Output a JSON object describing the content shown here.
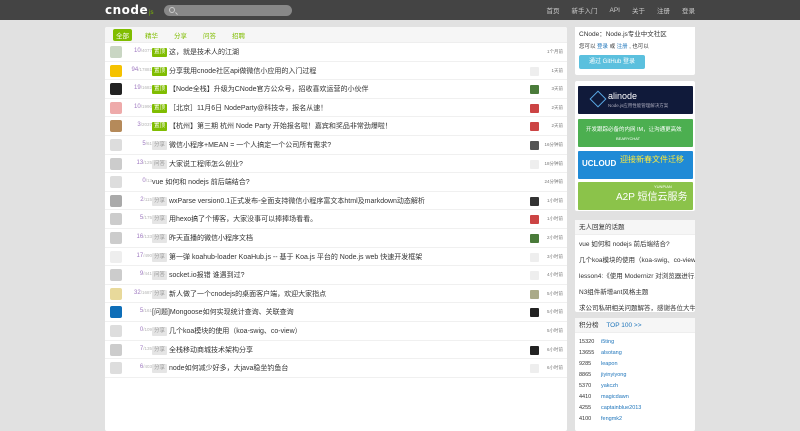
{
  "navbar": {
    "brand": "cnode",
    "brand_sub": "js",
    "links": [
      "首页",
      "新手入门",
      "API",
      "关于",
      "注册",
      "登录"
    ]
  },
  "tabs": [
    "全部",
    "精华",
    "分享",
    "问答",
    "招聘"
  ],
  "topics": [
    {
      "avatar_color": "#c9d6c3",
      "replies": "10",
      "visits": "/4077",
      "tag": "置顶",
      "tag_type": "top",
      "title": "这，就是技术人的江湖",
      "ravatar_color": "",
      "time": "1个月前"
    },
    {
      "avatar_color": "#f5c200",
      "replies": "94",
      "visits": "/17881",
      "tag": "置顶",
      "tag_type": "top",
      "title": "分享我用cnode社区api做微信小应用的入门过程",
      "ravatar_color": "#eee",
      "time": "1天前"
    },
    {
      "avatar_color": "#222",
      "replies": "19",
      "visits": "/1682",
      "tag": "置顶",
      "tag_type": "top",
      "title": "【Node全栈】升级为CNode官方公众号，招收喜欢运营的小伙伴",
      "ravatar_color": "#4a7b3a",
      "time": "3天前"
    },
    {
      "avatar_color": "#eaa",
      "replies": "10",
      "visits": "/1990",
      "tag": "置顶",
      "tag_type": "top",
      "title": "［北京］11月6日 NodeParty@科技寺，报名从速！",
      "ravatar_color": "#c44",
      "time": "2天前"
    },
    {
      "avatar_color": "#b58a5a",
      "replies": "3",
      "visits": "/2037",
      "tag": "置顶",
      "tag_type": "top",
      "title": "【杭州】第三期 杭州 Node Party 开始报名啦！嘉宾和奖品非常劲爆啦！",
      "ravatar_color": "#c44",
      "time": "2天前"
    },
    {
      "avatar_color": "#ddd",
      "replies": "5",
      "visits": "/61",
      "tag": "分享",
      "tag_type": "share",
      "title": "微信小程序+MEAN = 一个人搞定一个公司所有需求?",
      "ravatar_color": "#555",
      "time": "16分钟前"
    },
    {
      "avatar_color": "#ccc",
      "replies": "13",
      "visits": "/125",
      "tag": "问答",
      "tag_type": "share",
      "title": "大家说工程师怎么创业?",
      "ravatar_color": "#eee",
      "time": "18分钟前"
    },
    {
      "avatar_color": "#ddd",
      "replies": "0",
      "visits": "/13",
      "tag": "",
      "tag_type": "",
      "title": "vue 如何和 nodejs 前后端结合?",
      "ravatar_color": "",
      "time": "24分钟前"
    },
    {
      "avatar_color": "#aaa",
      "replies": "2",
      "visits": "/115",
      "tag": "分享",
      "tag_type": "share",
      "title": "wxParse version0.1正式发布-全面支持微信小程序富文本html及markdown动态解析",
      "ravatar_color": "#333",
      "time": "1小时前"
    },
    {
      "avatar_color": "#ccc",
      "replies": "5",
      "visits": "/175",
      "tag": "分享",
      "tag_type": "share",
      "title": "用hexo搞了个博客，大家没事可以捧捧场看看。",
      "ravatar_color": "#c44",
      "time": "1小时前"
    },
    {
      "avatar_color": "#ccc",
      "replies": "16",
      "visits": "/133",
      "tag": "分享",
      "tag_type": "share",
      "title": "昨天直播的微信小程序文档",
      "ravatar_color": "#4a7b3a",
      "time": "2小时前"
    },
    {
      "avatar_color": "#eee",
      "replies": "17",
      "visits": "/490",
      "tag": "分享",
      "tag_type": "share",
      "title": "第一弹 koahub-loader KoaHub.js -- 基于 Koa.js 平台的 Node.js web 快速开发框架",
      "ravatar_color": "#eee",
      "time": "3小时前"
    },
    {
      "avatar_color": "#ccc",
      "replies": "9",
      "visits": "/441",
      "tag": "问答",
      "tag_type": "share",
      "title": "socket.io报错 谁遇到过?",
      "ravatar_color": "#eee",
      "time": "4小时前"
    },
    {
      "avatar_color": "#e8d99b",
      "replies": "32",
      "visits": "/1687",
      "tag": "分享",
      "tag_type": "share",
      "title": "新人做了一个cnodejs的桌面客户端，欢迎大家指点",
      "ravatar_color": "#aa8",
      "time": "5小时前"
    },
    {
      "avatar_color": "#0e6eb8",
      "replies": "5",
      "visits": "/161",
      "tag": "",
      "tag_type": "",
      "title": "[问题]Mongoose如何实现统计查询、关联查询",
      "ravatar_color": "#222",
      "time": "5小时前"
    },
    {
      "avatar_color": "#ddd",
      "replies": "0",
      "visits": "/109",
      "tag": "分享",
      "tag_type": "share",
      "title": "几个koa模块的使用（koa-swig、co-view）",
      "ravatar_color": "",
      "time": "5小时前"
    },
    {
      "avatar_color": "#ccc",
      "replies": "7",
      "visits": "/135",
      "tag": "分享",
      "tag_type": "share",
      "title": "全栈移动商城技术架构分享",
      "ravatar_color": "#222",
      "time": "6小时前"
    },
    {
      "avatar_color": "#ddd",
      "replies": "6",
      "visits": "/403",
      "tag": "分享",
      "tag_type": "share",
      "title": "node如何减少好多，大java稳坐钓鱼台",
      "ravatar_color": "#eee",
      "time": "6小时前"
    }
  ],
  "sidebar": {
    "login": {
      "head": "CNode：Node.js专业中文社区",
      "text1": "您可以",
      "login_link": "登录",
      "text2": "或",
      "register_link": "注册",
      "text3": ", 也可以",
      "github_button": "通过 GitHub 登录"
    },
    "ads": [
      {
        "color": "#101a3a",
        "line1": "alinode",
        "line2": "Node.js应用性能管理解决方案"
      },
      {
        "color": "#4caf50",
        "line1": "开发跟踪必备的内网 IM，让沟通更高效",
        "line2": "BEARYCHAT"
      },
      {
        "color": "#1f8ad6",
        "line1": "UCLOUD",
        "line2": "迎接新春文件迁移"
      },
      {
        "color": "#8bc34a",
        "line1": "A2P 短信云服务",
        "line2": "YUNPIAN"
      }
    ],
    "no_reply": {
      "head": "无人回复的话题",
      "items": [
        "vue 如何和 nodejs 前后端结合?",
        "几个koa模块的使用（koa-swig、co-view）",
        "lesson4:《使用 Modernizr 对浏览器进行...",
        "N3组件新增ant风格主题",
        "求公司私研相关问题解答，感谢各位大牛..."
      ]
    },
    "score": {
      "head": "积分榜",
      "link": "TOP 100 >>",
      "rows": [
        {
          "score": "15320",
          "name": "i5ting"
        },
        {
          "score": "13655",
          "name": "alsotang"
        },
        {
          "score": "9285",
          "name": "leapon"
        },
        {
          "score": "8865",
          "name": "jiyinyiyong"
        },
        {
          "score": "5370",
          "name": "yakczh"
        },
        {
          "score": "4410",
          "name": "magicdawn"
        },
        {
          "score": "4255",
          "name": "captainblue2013"
        },
        {
          "score": "4100",
          "name": "fengmk2"
        }
      ]
    }
  }
}
